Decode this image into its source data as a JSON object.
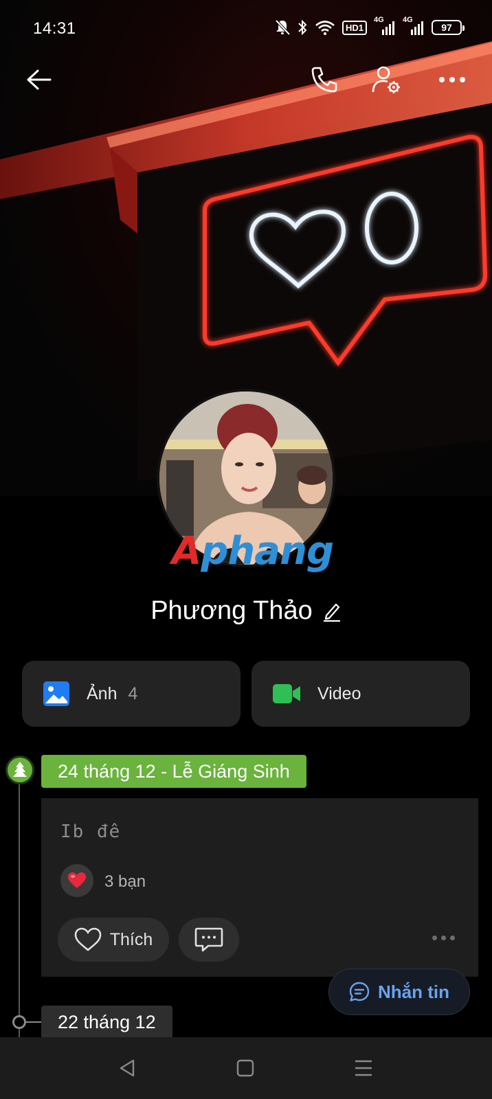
{
  "status_bar": {
    "time": "14:31",
    "hd_label": "HD1",
    "signal1_label": "4G",
    "signal2_label": "4G",
    "battery": "97",
    "icons": [
      "mute-bell-icon",
      "bluetooth-icon",
      "wifi-icon",
      "hd-icon",
      "signal-icon",
      "signal-icon",
      "battery-icon"
    ]
  },
  "app_bar": {
    "icons": [
      "back-arrow-icon",
      "phone-icon",
      "profile-settings-icon",
      "more-icon"
    ]
  },
  "cover": {
    "neon_counter": "0",
    "colors": {
      "neon_red": "#ff3b2a",
      "neon_white": "#e8f4ff"
    }
  },
  "avatar": {
    "watermark_part1": "A",
    "watermark_part2": "phang"
  },
  "profile": {
    "name": "Phương Thảo",
    "edit_icon": "pencil-icon"
  },
  "media_tiles": {
    "photos_label": "Ảnh",
    "photos_count": "4",
    "video_label": "Video",
    "colors": {
      "photos_icon": "#1f7cf2",
      "video_icon": "#2fbf55"
    }
  },
  "timeline": {
    "event_date": "24 tháng 12 - Lễ Giáng Sinh",
    "event_color": "#6ab33c",
    "post": {
      "text": "Ib đê",
      "reaction_count": "3 bạn",
      "like_label": "Thích"
    },
    "next_date": "22 tháng 12"
  },
  "message_fab": {
    "label": "Nhắn tin",
    "color": "#6aa3ef"
  },
  "nav_bar": {
    "icons": [
      "nav-back-icon",
      "nav-home-icon",
      "nav-recents-icon"
    ]
  }
}
